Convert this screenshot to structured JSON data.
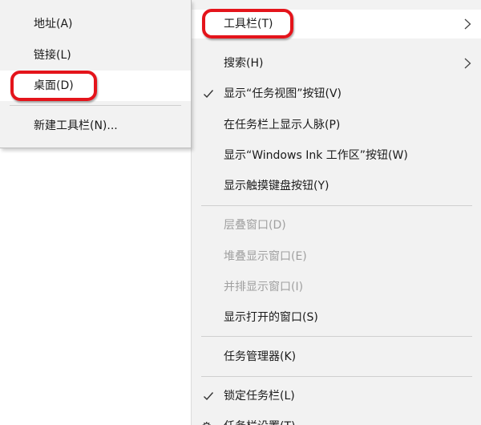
{
  "colors": {
    "menu_background": "#f2f2f2",
    "highlight": "#ffffff",
    "disabled_text": "#a0a0a0",
    "annotation": "#e4141b"
  },
  "submenu": {
    "items": [
      {
        "label": "地址(A)",
        "highlighted": false
      },
      {
        "label": "链接(L)",
        "highlighted": false
      },
      {
        "label": "桌面(D)",
        "highlighted": true,
        "annotated": true
      },
      {
        "label": "新建工具栏(N)...",
        "highlighted": false
      }
    ]
  },
  "menu": {
    "items": [
      {
        "label": "工具栏(T)",
        "submenu": true,
        "highlighted": true,
        "annotated": true
      },
      {
        "label": "搜索(H)",
        "submenu": true
      },
      {
        "label": "显示“任务视图”按钮(V)",
        "checked": true
      },
      {
        "label": "在任务栏上显示人脉(P)"
      },
      {
        "label": "显示“Windows Ink 工作区”按钮(W)"
      },
      {
        "label": "显示触摸键盘按钮(Y)"
      },
      {
        "label": "层叠窗口(D)",
        "disabled": true
      },
      {
        "label": "堆叠显示窗口(E)",
        "disabled": true
      },
      {
        "label": "并排显示窗口(I)",
        "disabled": true
      },
      {
        "label": "显示打开的窗口(S)"
      },
      {
        "label": "任务管理器(K)"
      },
      {
        "label": "锁定任务栏(L)",
        "checked": true
      },
      {
        "label": "任务栏设置(T)",
        "icon": "gear-icon"
      }
    ]
  }
}
